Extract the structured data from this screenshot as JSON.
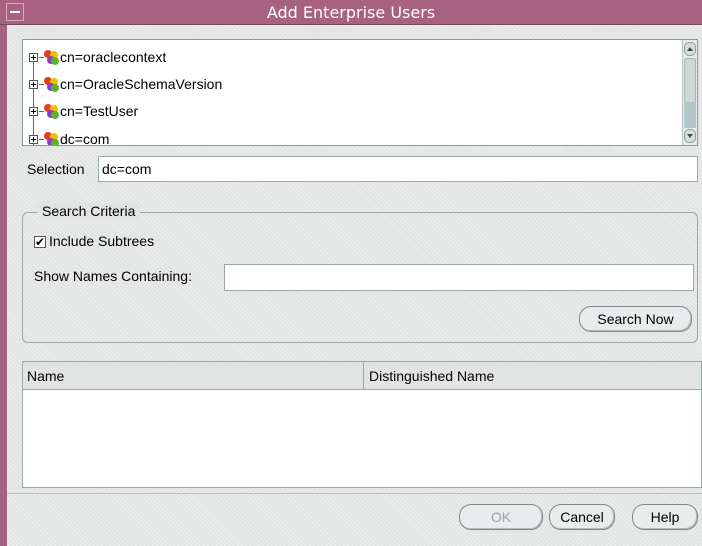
{
  "window": {
    "title": "Add Enterprise Users"
  },
  "tree": {
    "items": [
      {
        "label": "cn=oraclecontext"
      },
      {
        "label": "cn=OracleSchemaVersion"
      },
      {
        "label": "cn=TestUser"
      },
      {
        "label": "dc=com"
      }
    ]
  },
  "selection": {
    "label": "Selection",
    "value": "dc=com"
  },
  "search_criteria": {
    "legend": "Search Criteria",
    "include_subtrees_label": "Include Subtrees",
    "include_subtrees_checked": true,
    "show_names_label": "Show Names Containing:",
    "show_names_value": "",
    "search_button": "Search Now"
  },
  "results": {
    "columns": [
      "Name",
      "Distinguished Name"
    ],
    "rows": []
  },
  "buttons": {
    "ok": "OK",
    "cancel": "Cancel",
    "help": "Help"
  },
  "colors": {
    "titlebar": "#a6627f",
    "panel": "#e2e4e4"
  },
  "icons": [
    "window-menu-icon",
    "expand-icon",
    "directory-node-icon",
    "scroll-up-icon",
    "scroll-down-icon",
    "checkmark-icon"
  ]
}
